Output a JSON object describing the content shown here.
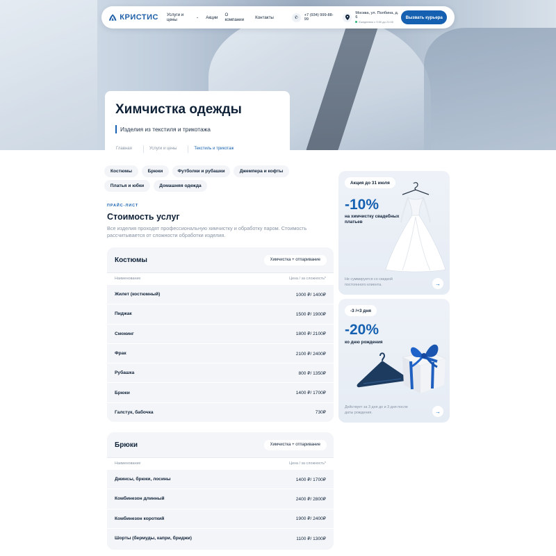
{
  "header": {
    "logo_text": "КРИСТИС",
    "nav": [
      {
        "label": "Услуги и цены",
        "has_dropdown": true
      },
      {
        "label": "Акции"
      },
      {
        "label": "О компании"
      },
      {
        "label": "Контакты"
      }
    ],
    "phone": "+7 (934) 999-88-99",
    "address": "Москва, ул. Полбина, д. 6",
    "hours": "Ежедневно с 9:00 до 21:00",
    "courier_button": "Вызвать курьера"
  },
  "hero": {
    "title": "Химчистка одежды",
    "subtitle": "Изделия из текстиля и трикотажа",
    "breadcrumb": [
      "Главная",
      "Услуги и цены",
      "Текстиль и трикотаж"
    ]
  },
  "categories": [
    "Костюмы",
    "Брюки",
    "Футболки и рубашки",
    "Джемпера и кофты",
    "Платья и юбки",
    "Домашняя одежда"
  ],
  "pricelist": {
    "eyebrow": "ПРАЙС-ЛИСТ",
    "title": "Стоимость услуг",
    "description": "Все изделия проходят профессиональную химчистку и обработку паром. Стоимость рассчитывается от сложности обработки изделия.",
    "col_name": "Наименование",
    "col_price": "Цена / за сложность*",
    "tables": [
      {
        "title": "Костюмы",
        "tag": "Химчистка + отпаривание",
        "rows": [
          {
            "name": "Жилет (костюмный)",
            "price": "1000 ₽/ 1400₽"
          },
          {
            "name": "Пиджак",
            "price": "1500 ₽/ 1900₽"
          },
          {
            "name": "Смокинг",
            "price": "1800 ₽/ 2100₽"
          },
          {
            "name": "Фрак",
            "price": "2100 ₽/ 2400₽"
          },
          {
            "name": "Рубашка",
            "price": "800 ₽/ 1350₽"
          },
          {
            "name": "Брюки",
            "price": "1400 ₽/ 1700₽"
          },
          {
            "name": "Галстук, бабочка",
            "price": "730₽"
          }
        ]
      },
      {
        "title": "Брюки",
        "tag": "Химчистка + отпаривание",
        "rows": [
          {
            "name": "Джинсы, брюки, лосины",
            "price": "1400 ₽/ 1700₽"
          },
          {
            "name": "Комбинезон длинный",
            "price": "2400 ₽/ 2800₽"
          },
          {
            "name": "Комбинезон короткий",
            "price": "1900 ₽/ 2400₽"
          },
          {
            "name": "Шорты (бермуды, капри, бриджи)",
            "price": "1100 ₽/ 1300₽"
          }
        ]
      }
    ]
  },
  "promos": [
    {
      "badge": "Акция до 31 июля",
      "percent": "-10%",
      "text": "на химчистку свадебных платьев",
      "note": "Не суммируется со скидкой постоянного клиента.",
      "image": "wedding-dress"
    },
    {
      "badge": "-3 /+3 дня",
      "percent": "-20%",
      "text": "ко дню рождения",
      "note": "Действует за 3 дня до и 3 дня после даты рождения.",
      "image": "gift-box-hanger"
    }
  ],
  "colors": {
    "accent": "#1560b0",
    "text": "#0f2137",
    "muted": "#8592a3",
    "panel": "#f3f5f9"
  }
}
